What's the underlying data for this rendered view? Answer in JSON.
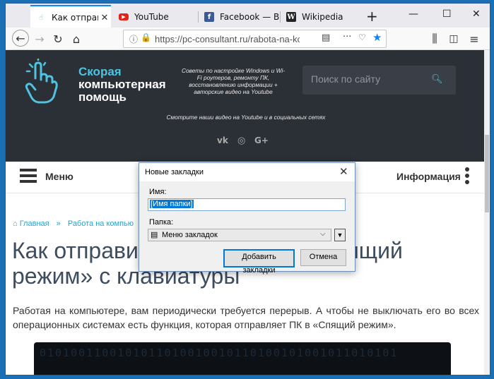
{
  "browser": {
    "tabs": [
      {
        "title": "Как отправить",
        "favicon": "bookmark-hand-icon",
        "active": true
      },
      {
        "title": "YouTube",
        "favicon": "youtube-icon",
        "active": false
      },
      {
        "title": "Facebook — Выполн",
        "favicon": "facebook-icon",
        "active": false
      },
      {
        "title": "Wikipedia",
        "favicon": "wikipedia-icon",
        "active": false
      }
    ],
    "url": "https://pc-consultant.ru/rabota-na-kom"
  },
  "site": {
    "logo_line1": "Скорая",
    "logo_line2": "компьютерная",
    "logo_line3": "помощь",
    "tagline": "Советы по настройке Windows и Wi-Fi роутеров, ремонту ПК, восстановлению информации + авторские видео на Youtube",
    "videos_text": "Смотрите наши видео на Youtube и в социальных сетях",
    "social": [
      "vk-icon",
      "instagram-icon",
      "google-plus-icon"
    ],
    "search_placeholder": "Поиск по сайту",
    "menu_label": "Меню",
    "info_label": "Информация"
  },
  "breadcrumbs": [
    "Главная",
    "Работа на компью"
  ],
  "article": {
    "title": "Как отправить компьютер в «Спящий режим» с клавиатуры",
    "paragraph": "Работая на компьютере, вам периодически требуется перерыв. А чтобы не выключать его во всех операционных системах есть функция, которая отправляет ПК в «Спящий режим».",
    "image_bits": "0101001100101011010010010110100101001011010101"
  },
  "dialog": {
    "title": "Новые закладки",
    "name_label": "Имя:",
    "name_value": "[Имя папки]",
    "folder_label": "Папка:",
    "folder_value": "Меню закладок",
    "add_button": "Добавить закладки",
    "cancel_button": "Отмена"
  },
  "colors": {
    "accent": "#0a84ff",
    "header_bg": "#2b2f36",
    "brand_cyan": "#4fc3e0",
    "title_color": "#3d4c5e"
  }
}
